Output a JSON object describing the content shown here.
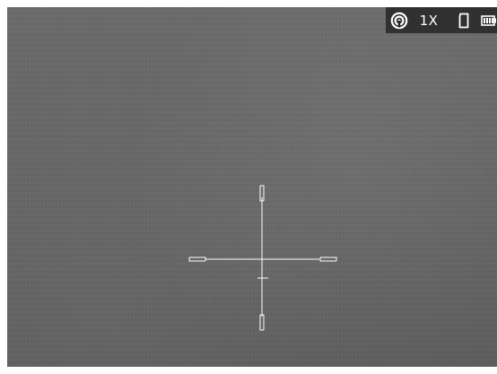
{
  "status_bar": {
    "zoom": "1X",
    "icons": [
      "wifi-hotspot-icon",
      "sd-card-icon",
      "battery-icon"
    ],
    "bg_color": "#232323",
    "fg_color": "#ffffff"
  },
  "reticle": {
    "type": "crosshair",
    "color": "#ffffff"
  }
}
